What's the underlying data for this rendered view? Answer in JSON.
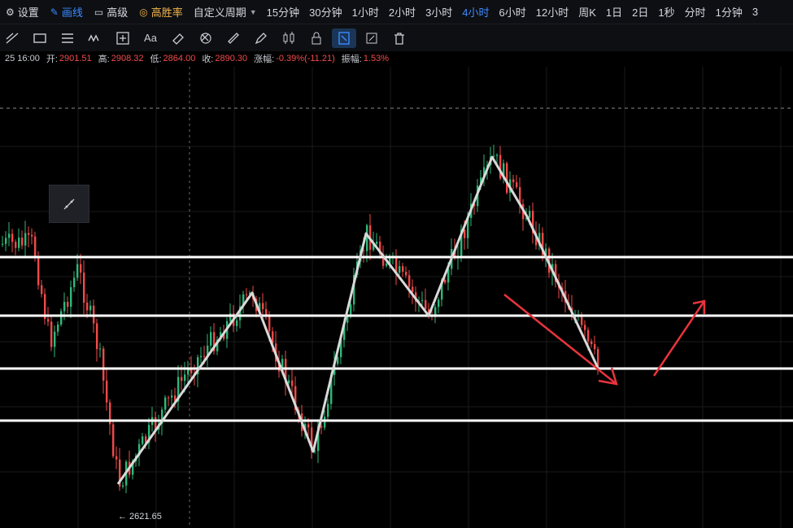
{
  "topbar": {
    "settings": "设置",
    "draw": "画线",
    "advanced": "高级",
    "winrate": "高胜率",
    "custom_period": "自定义周期",
    "periods": [
      "15分钟",
      "30分钟",
      "1小时",
      "2小时",
      "3小时",
      "4小时",
      "6小时",
      "12小时",
      "周K",
      "1日",
      "2日",
      "1秒",
      "分时",
      "1分钟",
      "3"
    ],
    "active_period": "4小时"
  },
  "toolbar": {
    "text_tool": "Aa",
    "icons": [
      "trend-line-icon",
      "rectangle-icon",
      "parallel-lines-icon",
      "fib-wave-icon",
      "measure-icon",
      "text-icon",
      "eraser-icon",
      "magnet-icon",
      "ruler-icon",
      "pen-icon",
      "candles-icon",
      "lock-icon",
      "select-icon",
      "edit-icon",
      "trash-icon"
    ]
  },
  "ohlc": {
    "time": "25 16:00",
    "open_label": "开:",
    "open": "2901.51",
    "high_label": "高:",
    "high": "2908.32",
    "low_label": "低:",
    "low": "2864.00",
    "close_label": "收:",
    "close": "2890.30",
    "change_label": "涨幅:",
    "change": "-0.39%(-11.21)",
    "amp_label": "振幅:",
    "amp": "1.53%"
  },
  "chart": {
    "low_marker": "← 2621.65",
    "colors": {
      "up": "#2fb87a",
      "down": "#f04a4a",
      "zigzag": "#d9d9d9",
      "arrow": "#e8343c",
      "level": "#ffffff",
      "grid": "#1a1a1a"
    }
  }
}
